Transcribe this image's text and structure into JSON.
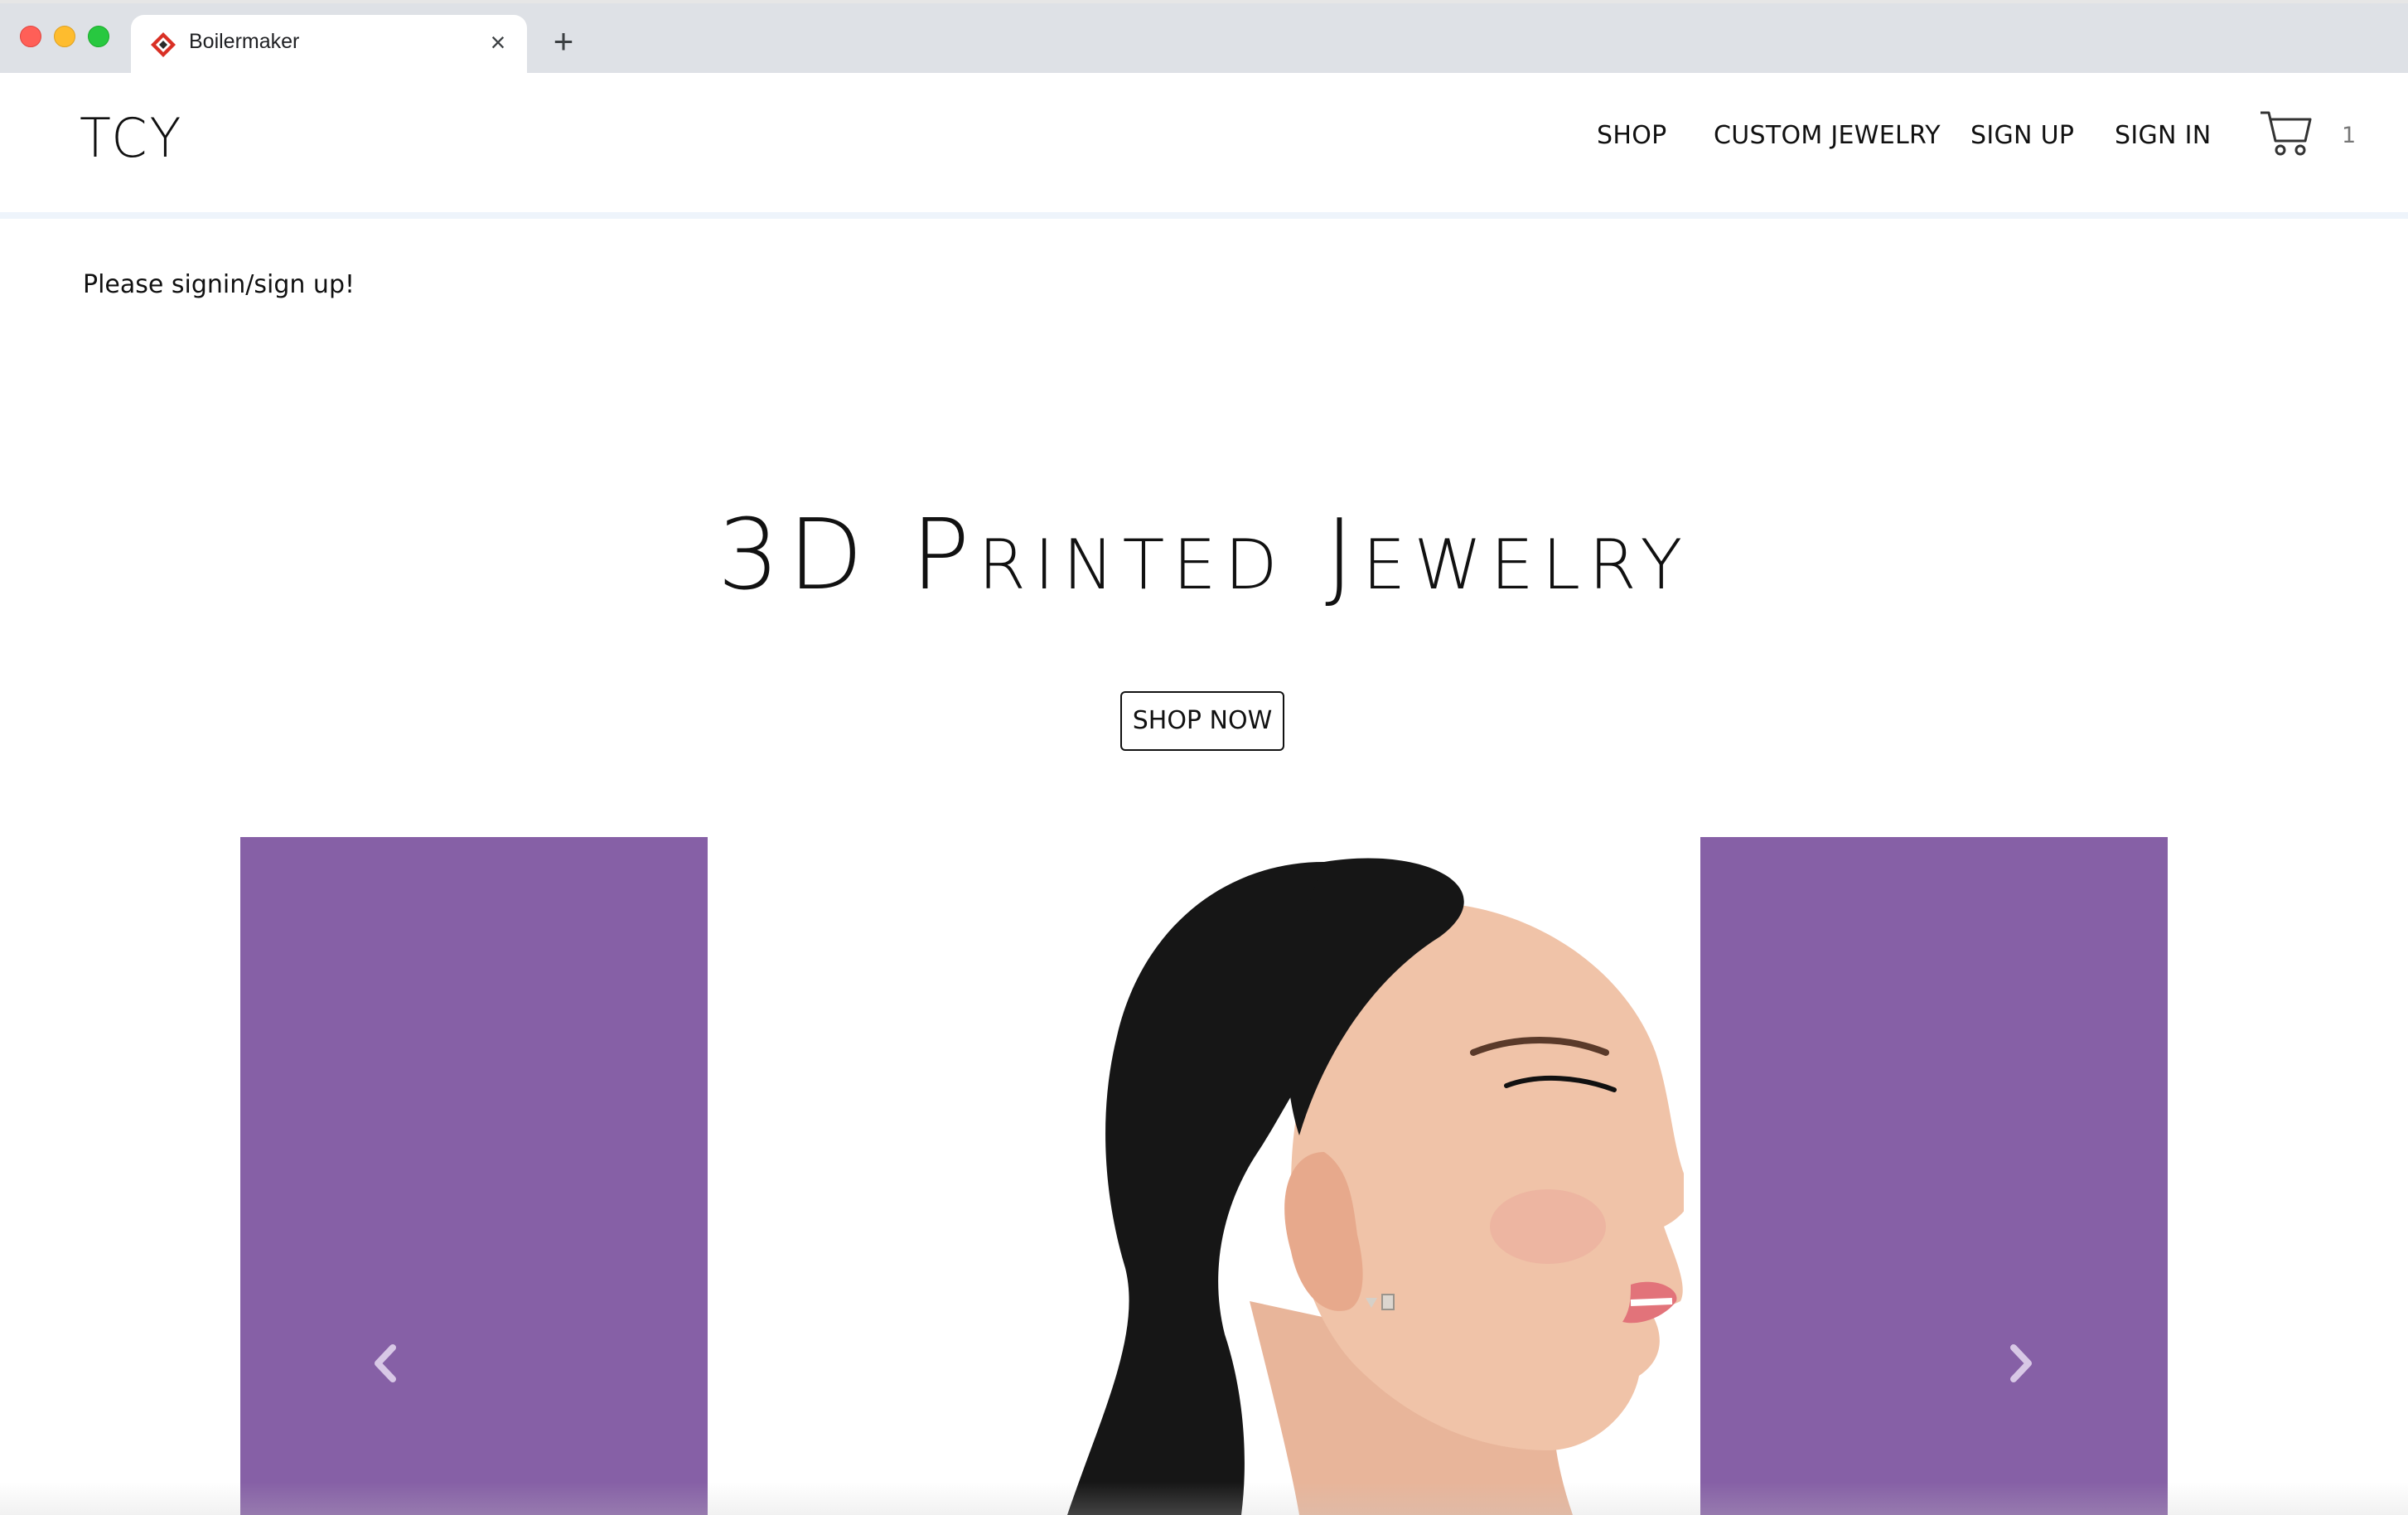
{
  "browser": {
    "tab_title": "Boilermaker",
    "close_glyph": "×",
    "new_tab_glyph": "+",
    "favicon": "boilermaker-diamond-icon"
  },
  "header": {
    "logo": "TCY",
    "nav": {
      "shop": "SHOP",
      "custom_jewelry": "CUSTOM JEWELRY",
      "sign_up": "SIGN UP",
      "sign_in": "SIGN IN"
    },
    "cart_icon": "cart-icon",
    "cart_count": "1"
  },
  "main": {
    "message": "Please signin/sign up!",
    "hero_title": "3D Printed Jewelry",
    "shop_now_label": "SHOP NOW"
  },
  "carousel": {
    "panel_color": "#8660a6",
    "prev_icon": "chevron-left-icon",
    "next_icon": "chevron-right-icon",
    "image": "woman-profile-earring-photo"
  },
  "colors": {
    "accent_purple": "#8660a6",
    "chrome_bg": "#dee1e6"
  }
}
